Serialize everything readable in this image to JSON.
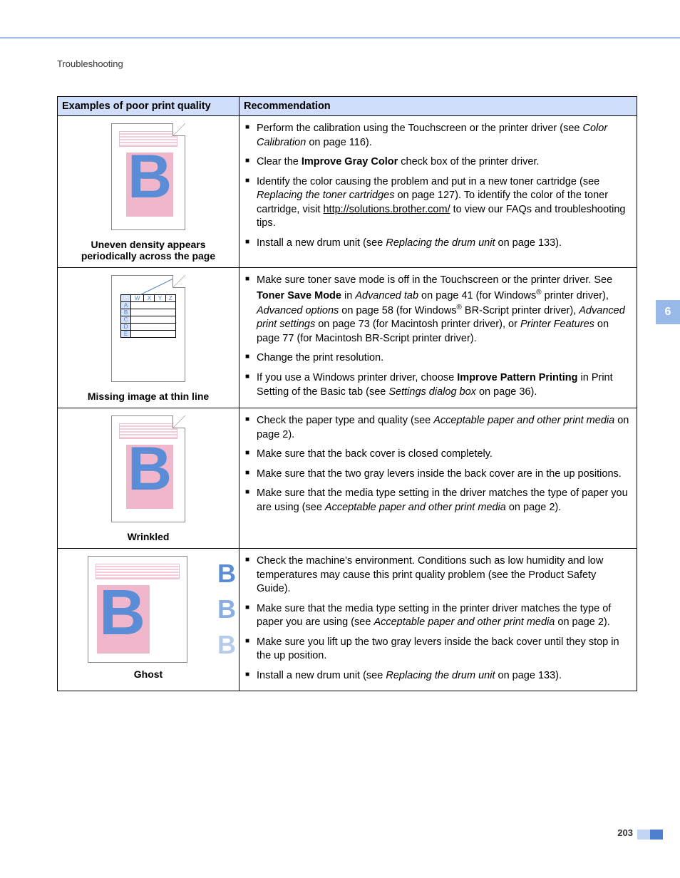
{
  "sectionHeader": "Troubleshooting",
  "headers": {
    "col1": "Examples of poor print quality",
    "col2": "Recommendation"
  },
  "rows": [
    {
      "caption1": "Uneven density appears",
      "caption2": "periodically across the page",
      "items": [
        [
          {
            "t": "Perform the calibration using the Touchscreen or the printer driver (see "
          },
          {
            "t": "Color Calibration",
            "i": true
          },
          {
            "t": " on page 116)."
          }
        ],
        [
          {
            "t": "Clear the "
          },
          {
            "t": "Improve Gray Color",
            "b": true
          },
          {
            "t": " check box of the printer driver."
          }
        ],
        [
          {
            "t": "Identify the color causing the problem and put in a new toner cartridge (see "
          },
          {
            "t": "Replacing the toner cartridges",
            "i": true
          },
          {
            "t": " on page 127). To identify the color of the toner cartridge, visit "
          },
          {
            "t": "http://solutions.brother.com/",
            "u": true
          },
          {
            "t": " to view our FAQs and troubleshooting tips."
          }
        ],
        [
          {
            "t": "Install a new drum unit (see "
          },
          {
            "t": "Replacing the drum unit",
            "i": true
          },
          {
            "t": " on page 133)."
          }
        ]
      ]
    },
    {
      "caption1": "Missing image at thin line",
      "items": [
        [
          {
            "t": "Make sure toner save mode is off in the Touchscreen or the printer driver. See "
          },
          {
            "t": "Toner Save Mode",
            "b": true
          },
          {
            "t": " in "
          },
          {
            "t": "Advanced tab",
            "i": true
          },
          {
            "t": " on page 41 (for Windows"
          },
          {
            "t": "®",
            "sup": true
          },
          {
            "t": " printer driver), "
          },
          {
            "t": "Advanced options",
            "i": true
          },
          {
            "t": " on page 58 (for Windows"
          },
          {
            "t": "®",
            "sup": true
          },
          {
            "t": " BR-Script printer driver), "
          },
          {
            "t": "Advanced print settings",
            "i": true
          },
          {
            "t": " on page 73 (for Macintosh printer driver), or "
          },
          {
            "t": "Printer Features",
            "i": true
          },
          {
            "t": " on page 77 (for Macintosh BR-Script printer driver)."
          }
        ],
        [
          {
            "t": "Change the print resolution."
          }
        ],
        [
          {
            "t": "If you use a Windows printer driver, choose "
          },
          {
            "t": "Improve Pattern Printing",
            "b": true
          },
          {
            "t": " in Print Setting of the Basic tab (see "
          },
          {
            "t": "Settings dialog box",
            "i": true
          },
          {
            "t": " on page 36)."
          }
        ]
      ],
      "gridTop": [
        "W",
        "X",
        "Y",
        "Z"
      ],
      "gridSide": [
        "A",
        "B",
        "C",
        "D",
        "E"
      ]
    },
    {
      "caption1": "Wrinkled",
      "items": [
        [
          {
            "t": "Check the paper type and quality (see "
          },
          {
            "t": "Acceptable paper and other print media",
            "i": true
          },
          {
            "t": " on page 2)."
          }
        ],
        [
          {
            "t": "Make sure that the back cover is closed completely."
          }
        ],
        [
          {
            "t": "Make sure that the two gray levers inside the back cover are in the up positions."
          }
        ],
        [
          {
            "t": "Make sure that the media type setting in the driver matches the type of paper you are using (see "
          },
          {
            "t": "Acceptable paper and other print media",
            "i": true
          },
          {
            "t": " on page 2)."
          }
        ]
      ]
    },
    {
      "caption1": "Ghost",
      "items": [
        [
          {
            "t": "Check the machine's environment. Conditions such as low humidity and low temperatures may cause this print quality problem (see the Product Safety Guide)."
          }
        ],
        [
          {
            "t": "Make sure that the media type setting in the printer driver matches the type of paper you are using (see "
          },
          {
            "t": "Acceptable paper and other print media",
            "i": true
          },
          {
            "t": " on page 2)."
          }
        ],
        [
          {
            "t": "Make sure you lift up the two gray levers inside the back cover until they stop in the up position."
          }
        ],
        [
          {
            "t": "Install a new drum unit (see "
          },
          {
            "t": "Replacing the drum unit ",
            "i": true
          },
          {
            "t": "on page 133)."
          }
        ]
      ]
    }
  ],
  "sideTab": "6",
  "pageNumber": "203"
}
